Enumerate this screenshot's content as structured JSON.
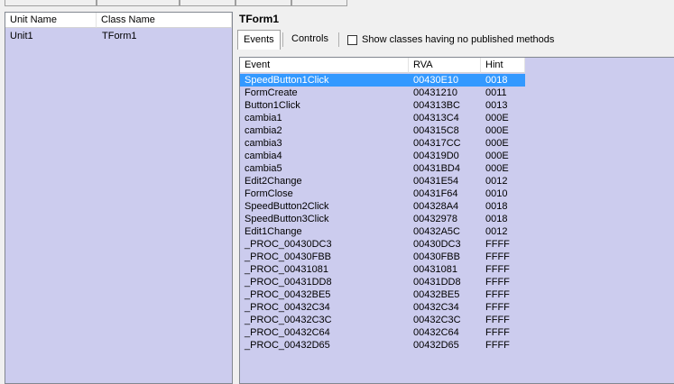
{
  "units_panel": {
    "col_unit": "Unit Name",
    "col_class": "Class Name",
    "rows": [
      {
        "unit": "Unit1",
        "class": "TForm1"
      }
    ]
  },
  "form_title": "TForm1",
  "tabs": [
    {
      "label": "Events"
    },
    {
      "label": "Controls"
    }
  ],
  "show_classes_label": "Show classes having no published methods",
  "events_grid": {
    "col_event": "Event",
    "col_rva": "RVA",
    "col_hint": "Hint",
    "rows": [
      {
        "event": "SpeedButton1Click",
        "rva": "00430E10",
        "hint": "0018"
      },
      {
        "event": "FormCreate",
        "rva": "00431210",
        "hint": "0011"
      },
      {
        "event": "Button1Click",
        "rva": "004313BC",
        "hint": "0013"
      },
      {
        "event": "cambia1",
        "rva": "004313C4",
        "hint": "000E"
      },
      {
        "event": "cambia2",
        "rva": "004315C8",
        "hint": "000E"
      },
      {
        "event": "cambia3",
        "rva": "004317CC",
        "hint": "000E"
      },
      {
        "event": "cambia4",
        "rva": "004319D0",
        "hint": "000E"
      },
      {
        "event": "cambia5",
        "rva": "00431BD4",
        "hint": "000E"
      },
      {
        "event": "Edit2Change",
        "rva": "00431E54",
        "hint": "0012"
      },
      {
        "event": "FormClose",
        "rva": "00431F64",
        "hint": "0010"
      },
      {
        "event": "SpeedButton2Click",
        "rva": "004328A4",
        "hint": "0018"
      },
      {
        "event": "SpeedButton3Click",
        "rva": "00432978",
        "hint": "0018"
      },
      {
        "event": "Edit1Change",
        "rva": "00432A5C",
        "hint": "0012"
      },
      {
        "event": "_PROC_00430DC3",
        "rva": "00430DC3",
        "hint": "FFFF"
      },
      {
        "event": "_PROC_00430FBB",
        "rva": "00430FBB",
        "hint": "FFFF"
      },
      {
        "event": "_PROC_00431081",
        "rva": "00431081",
        "hint": "FFFF"
      },
      {
        "event": "_PROC_00431DD8",
        "rva": "00431DD8",
        "hint": "FFFF"
      },
      {
        "event": "_PROC_00432BE5",
        "rva": "00432BE5",
        "hint": "FFFF"
      },
      {
        "event": "_PROC_00432C34",
        "rva": "00432C34",
        "hint": "FFFF"
      },
      {
        "event": "_PROC_00432C3C",
        "rva": "00432C3C",
        "hint": "FFFF"
      },
      {
        "event": "_PROC_00432C64",
        "rva": "00432C64",
        "hint": "FFFF"
      },
      {
        "event": "_PROC_00432D65",
        "rva": "00432D65",
        "hint": "FFFF"
      }
    ]
  }
}
